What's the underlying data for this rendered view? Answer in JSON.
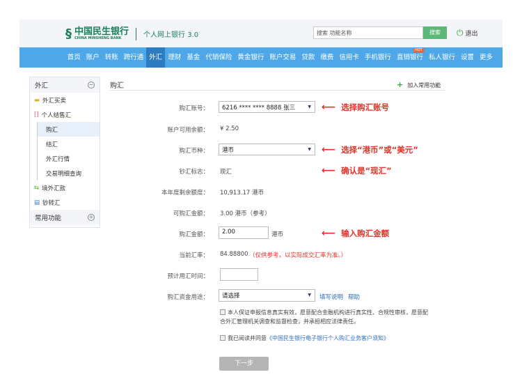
{
  "header": {
    "logo_cn": "中国民生银行",
    "logo_en": "CHINA MINSHENG BANK",
    "product": "个人网上银行 3.0",
    "search_placeholder": "搜索 功能名称",
    "search_btn": "搜索",
    "logout": "退出"
  },
  "nav": {
    "items": [
      "首页",
      "账户",
      "转账",
      "跨行通",
      "外汇",
      "理财",
      "基金",
      "代销保险",
      "黄金银行",
      "账户交易",
      "贷款",
      "缴费",
      "信用卡",
      "手机银行",
      "直销银行",
      "私人银行",
      "设置",
      "更多"
    ],
    "active": "外汇",
    "hot_badge": "HOT"
  },
  "sidebar": {
    "section": "外汇",
    "items": [
      {
        "label": "外汇买卖"
      },
      {
        "label": "个人结售汇"
      }
    ],
    "subitems": [
      "购汇",
      "结汇",
      "外汇行情",
      "交易明细查询"
    ],
    "items2": [
      "境外汇款",
      "钞转汇"
    ],
    "section2": "常用功能"
  },
  "page": {
    "title": "购汇",
    "add_fav": "加入常用功能"
  },
  "form": {
    "account_label": "购汇账号：",
    "account_value": "6216 **** **** 8888 张三",
    "balance_label": "账户可用余额：",
    "balance_value": "¥ 2.50",
    "currency_label": "购汇币种：",
    "currency_value": "港币",
    "flag_label": "钞汇标志：",
    "flag_value": "现汇",
    "quota_label": "本年度剩余额度：",
    "quota_value": "10,913.17 港币",
    "avail_label": "可购汇金额：",
    "avail_value": "3.00 港币（参考）",
    "amount_label": "购汇金额：",
    "amount_value": "2.00",
    "amount_unit": "港币",
    "rate_label": "当前汇率：",
    "rate_value": "84.88800",
    "rate_note": "（仅供参考，以实际成交汇率为准。）",
    "time_label": "预计用汇时间：",
    "time_value": "",
    "purpose_label": "购汇资金用途：",
    "purpose_value": "请选择",
    "fill_help": "填写说明",
    "help": "帮助",
    "check1": "本人保证申报信息真实有效，愿意配合金融机构进行真实性、合规性审核，愿意配合外汇管理机关调查和监督检查，并承担相应法律责任。",
    "check2_text": "我已阅读并同意",
    "check2_link": "《中国民生银行电子银行个人购汇业务客户须知》",
    "next": "下一步"
  },
  "annotations": [
    "选择购汇账号",
    "选择“港币”或“美元”",
    "确认是“现汇”",
    "输入购汇金额"
  ]
}
